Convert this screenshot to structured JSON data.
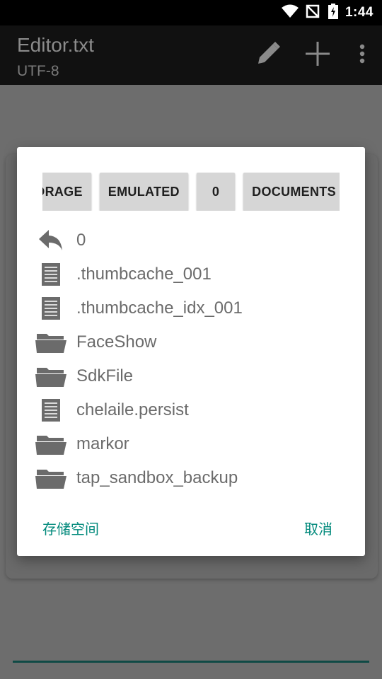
{
  "status_bar": {
    "time": "1:44"
  },
  "app_bar": {
    "title": "Editor.txt",
    "subtitle": "UTF-8",
    "actions": [
      "pencil-icon",
      "plus-icon",
      "more-vert-icon"
    ]
  },
  "dialog": {
    "breadcrumbs": [
      "STORAGE",
      "EMULATED",
      "0",
      "DOCUMENTS"
    ],
    "items": [
      {
        "label": "0",
        "icon": "back-arrow-icon"
      },
      {
        "label": ".thumbcache_001",
        "icon": "file-icon"
      },
      {
        "label": ".thumbcache_idx_001",
        "icon": "file-icon"
      },
      {
        "label": "FaceShow",
        "icon": "folder-icon"
      },
      {
        "label": "SdkFile",
        "icon": "folder-icon"
      },
      {
        "label": "chelaile.persist",
        "icon": "file-icon"
      },
      {
        "label": "markor",
        "icon": "folder-icon"
      },
      {
        "label": "tap_sandbox_backup",
        "icon": "folder-icon"
      }
    ],
    "storage_button": "存储空间",
    "cancel_button": "取消"
  },
  "colors": {
    "accent": "#00897b",
    "status_bar": "#000000",
    "scrim": "#6e6e6e"
  }
}
